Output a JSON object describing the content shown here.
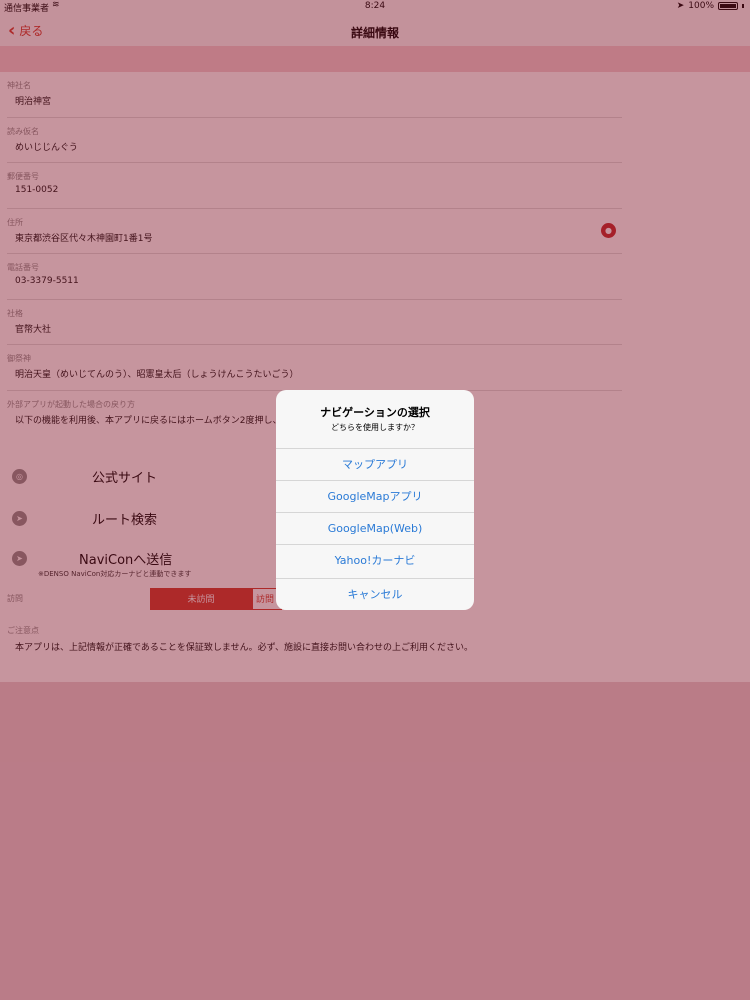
{
  "status_bar": {
    "carrier": "通信事業者",
    "time": "8:24",
    "battery": "100%"
  },
  "nav": {
    "back_label": "戻る",
    "title": "詳細情報"
  },
  "fields": [
    {
      "label": "神社名",
      "value": "明治神宮"
    },
    {
      "label": "読み仮名",
      "value": "めいじじんぐう"
    },
    {
      "label": "郵便番号",
      "value": "151-0052"
    },
    {
      "label": "住所",
      "value": "東京都渋谷区代々木神園町1番1号"
    },
    {
      "label": "電話番号",
      "value": "03-3379-5511"
    },
    {
      "label": "社格",
      "value": "官幣大社"
    },
    {
      "label": "御祭神",
      "value": "明治天皇（めいじてんのう）、昭憲皇太后（しょうけんこうたいごう）"
    },
    {
      "label": "外部アプリが起動した場合の戻り方",
      "value": "以下の機能を利用後、本アプリに戻るにはホームボタン2度押し、"
    }
  ],
  "links": {
    "official": "公式サイト",
    "route": "ルート検索",
    "navicon": "NaviConへ送信",
    "navicon_note": "※DENSO NaviCon対応カーナビと連動できます"
  },
  "visit": {
    "label": "訪問",
    "not_visited": "未訪問",
    "visited": "訪問済み"
  },
  "notes": {
    "label": "ご注意点",
    "text": "本アプリは、上記情報が正確であることを保証致しません。必ず、施設に直接お問い合わせの上ご利用ください。"
  },
  "dialog": {
    "title": "ナビゲーションの選択",
    "message": "どちらを使用しますか？",
    "options": [
      "マップアプリ",
      "GoogleMapアプリ",
      "GoogleMap(Web)",
      "Yahoo!カーナビ",
      "キャンセル"
    ]
  },
  "colors": {
    "accent": "#d23b2b",
    "link_blue": "#2a7ad6",
    "overlay": "#8e1a2e"
  }
}
